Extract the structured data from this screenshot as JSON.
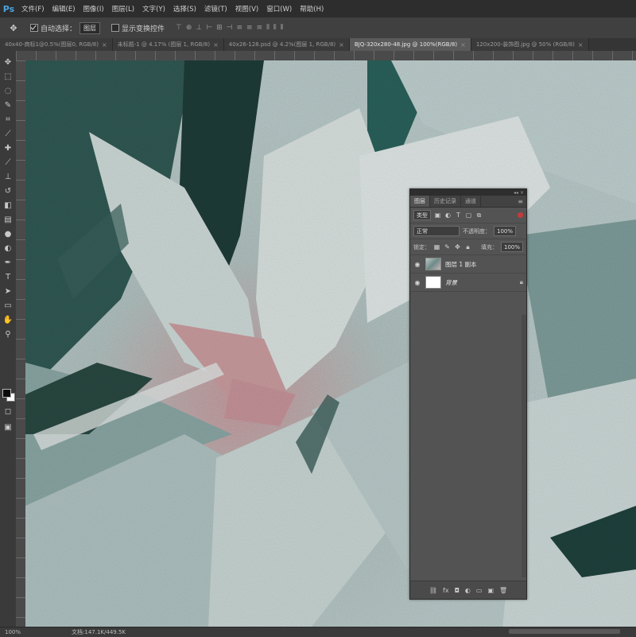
{
  "app": {
    "logo": "Ps"
  },
  "menu": [
    "文件(F)",
    "编辑(E)",
    "图像(I)",
    "图层(L)",
    "文字(Y)",
    "选择(S)",
    "滤镜(T)",
    "视图(V)",
    "窗口(W)",
    "帮助(H)"
  ],
  "options": {
    "auto_select_label": "自动选择：",
    "auto_select_value": "图层",
    "show_transform_label": "显示变换控件"
  },
  "tabs": [
    {
      "label": "40x40-商标1@0.5%(图层0, RGB/8)",
      "active": false
    },
    {
      "label": "未标题-1 @ 4.17% (图层 1, RGB/8)",
      "active": false
    },
    {
      "label": "40x26-128.psd @ 4.2%(图层 1, RGB/8)",
      "active": false
    },
    {
      "label": "BJQ-320x280-48.jpg @ 100%(RGB/8)",
      "active": true
    },
    {
      "label": "120x200-装饰图.jpg @ 50% (RGB/8)",
      "active": false
    }
  ],
  "layers_panel": {
    "tabs": [
      "图层",
      "历史记录",
      "通道"
    ],
    "active_tab": 0,
    "filter_kind": "类型",
    "blend_mode": "正常",
    "opacity_label": "不透明度：",
    "opacity_value": "100%",
    "lock_label": "锁定：",
    "fill_label": "填充：",
    "fill_value": "100%",
    "layers": [
      {
        "name": "图层 1 副本",
        "visible": true,
        "selected": false,
        "thumb": "image",
        "locked": false
      },
      {
        "name": "背景",
        "visible": true,
        "selected": false,
        "thumb": "white",
        "locked": true
      }
    ]
  },
  "status": {
    "zoom": "100%",
    "doc": "文档:147.1K/449.5K"
  },
  "colors": {
    "foreground": "#0b0b0b",
    "background": "#ffffff",
    "ui_dark": "#2d2d2d",
    "panel": "#535353"
  },
  "icons": {
    "toolbar": [
      "move-icon",
      "marquee-icon",
      "lasso-icon",
      "quick-select-icon",
      "crop-icon",
      "eyedropper-icon",
      "healing-icon",
      "brush-icon",
      "clone-stamp-icon",
      "history-brush-icon",
      "eraser-icon",
      "gradient-icon",
      "blur-icon",
      "dodge-icon",
      "pen-icon",
      "type-icon",
      "path-select-icon",
      "shape-icon",
      "hand-icon",
      "zoom-icon"
    ]
  }
}
